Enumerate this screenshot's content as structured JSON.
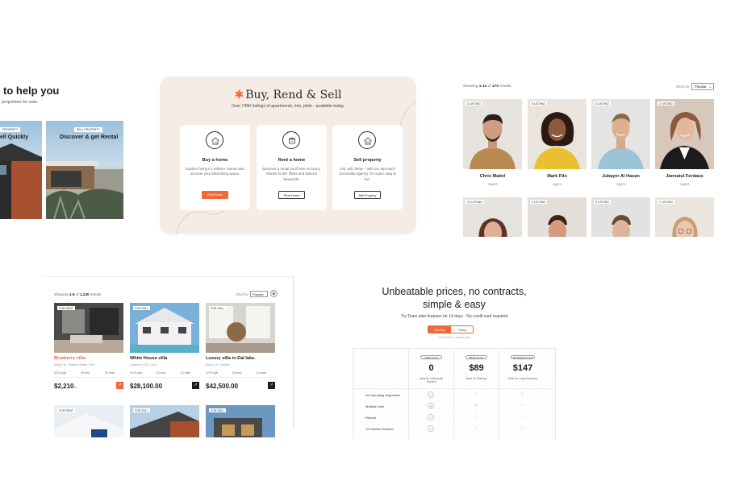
{
  "hero_panel": {
    "heading": "to help you",
    "subtext": "properties for sale.",
    "cards": [
      {
        "tag": "PROPERTY",
        "title": "ell Quickly"
      },
      {
        "tag": "SELL PROPERTY",
        "title": "Discover & get Rental"
      }
    ]
  },
  "services_panel": {
    "title": "Buy, Rend & Sell",
    "subtitle": "Over 745K listings of apartments, lots, plots - available today.",
    "services": [
      {
        "icon": "house-search-icon",
        "title": "Buy a home",
        "desc": "Explore homy's 2 million+ homes and uncover your ideal living space.",
        "button": "Find Home"
      },
      {
        "icon": "rent-sign-icon",
        "title": "Rent a home",
        "desc": "Discover a rental you'll love on homy, thanks to 35+ filters and tailored keywords.",
        "button": "Rent Home"
      },
      {
        "icon": "house-dollar-icon",
        "title": "Sell property",
        "desc": "List, sell, thrive – with our top-notch real estate agency. It's super easy & fun.",
        "button": "Sell Property"
      }
    ]
  },
  "agents_panel": {
    "showing_prefix": "Showing ",
    "showing_range": "1-12",
    "showing_of": " of ",
    "showing_total": "170",
    "showing_suffix": " results",
    "sort_label": "Short by:",
    "sort_value": "Popular",
    "agents": [
      {
        "listings": "3 LISTING",
        "name": "Chris Matiel",
        "role": "Agent"
      },
      {
        "listings": "5 LISTING",
        "name": "Mark Filo",
        "role": "Agent"
      },
      {
        "listings": "4 LISTING",
        "name": "Jubayer Al Hasan",
        "role": "Agent"
      },
      {
        "listings": "2 LISTING",
        "name": "Jannatul Ferdaus",
        "role": "Agent"
      },
      {
        "listings": "10 LISTING"
      },
      {
        "listings": "2 LISTING"
      },
      {
        "listings": "9 LISTING"
      },
      {
        "listings": "7 LISTING"
      }
    ]
  },
  "listings_panel": {
    "showing_prefix": "Showing ",
    "showing_range": "1-6",
    "showing_of": " of ",
    "showing_total": "1,230",
    "showing_suffix": " results",
    "sort_label": "Short by:",
    "sort_value": "Popular",
    "listings": [
      {
        "tag": "FOR RENT",
        "name": "Blueberry villa.",
        "address": "Mirpur 10, Stadium dhaka 1208",
        "sqft": "3210 sqft",
        "beds": "03 bed",
        "baths": "02 bath",
        "price": "$2,210",
        "per": "/m",
        "highlight": true
      },
      {
        "tag": "FOR SELL",
        "name": "White House villa",
        "address": "California 2112, USA",
        "sqft": "1270 sqft",
        "beds": "02 bed",
        "baths": "01 bath",
        "price": "$28,100.00",
        "per": "",
        "highlight": false
      },
      {
        "tag": "FOR SELL",
        "name": "Luxury villa in Dal lake.",
        "address": "Mirpur 10, Stadium",
        "sqft": "1270 sqft",
        "beds": "02 bed",
        "baths": "01 bath",
        "price": "$42,500.00",
        "per": "",
        "highlight": false
      },
      {
        "tag": "FOR RENT"
      },
      {
        "tag": "FOR SELL"
      },
      {
        "tag": "FOR SELL"
      }
    ]
  },
  "pricing_panel": {
    "title_line1": "Unbeatable prices, no contracts,",
    "title_line2": "simple & easy",
    "subtitle": "Try Team plan features for 14 days · No credit card required",
    "toggle": [
      "Monthly",
      "Yearly"
    ],
    "save_note": "Save 30% on annual plan",
    "plans": [
      {
        "tag": "FREE PLAN",
        "price": "0",
        "desc": "Ideal for Individuals Starters"
      },
      {
        "tag": "BASIC PLAN",
        "price": "$89",
        "desc": "Ideal for Startups"
      },
      {
        "tag": "BUSINESS PLAN",
        "price": "$147",
        "desc": "Ideal for Large Business"
      }
    ],
    "features": [
      "All Operating Supported",
      "Multiple User",
      "Refund",
      "12 months Duration"
    ]
  },
  "colors": {
    "accent": "#ef6a34",
    "panel_bg": "#f6ece6",
    "dark": "#1c1c1c"
  }
}
